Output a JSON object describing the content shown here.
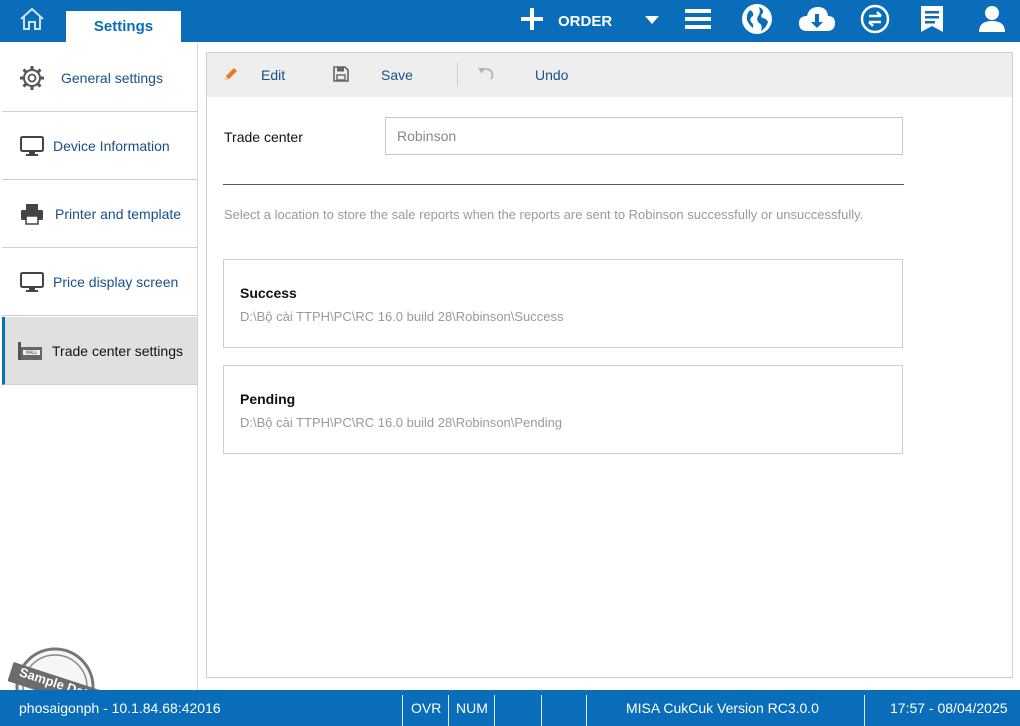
{
  "topbar": {
    "tab_label": "Settings",
    "order_label": "ORDER",
    "icons": [
      "home-icon",
      "plus-icon",
      "dropdown-arrow-icon",
      "menu-icon",
      "globe-icon",
      "cloud-download-icon",
      "sync-icon",
      "receipt-icon",
      "user-icon"
    ],
    "accent_color": "#0a6db9"
  },
  "sidebar": {
    "items": [
      {
        "label": "General settings",
        "icon": "gear-icon"
      },
      {
        "label": "Device Information",
        "icon": "monitor-icon"
      },
      {
        "label": "Printer and template",
        "icon": "printer-icon"
      },
      {
        "label": "Price display screen",
        "icon": "monitor-icon"
      },
      {
        "label": "Trade center settings",
        "icon": "mall-icon"
      }
    ],
    "active_index": 4,
    "stamp_text": "Sample Data"
  },
  "toolbar": {
    "edit_label": "Edit",
    "save_label": "Save",
    "undo_label": "Undo"
  },
  "form": {
    "trade_center_label": "Trade center",
    "trade_center_value": "Robinson",
    "hint": "Select a location to store the sale reports when the reports are sent to Robinson successfully or unsuccessfully.",
    "locations": [
      {
        "title": "Success",
        "path": "D:\\Bộ cài TTPH\\PC\\RC 16.0 build 28\\Robinson\\Success"
      },
      {
        "title": "Pending",
        "path": "D:\\Bộ cài TTPH\\PC\\RC 16.0 build 28\\Robinson\\Pending"
      }
    ]
  },
  "statusbar": {
    "user": "phosaigonph - 10.1.84.68:42016",
    "ovr": "OVR",
    "num": "NUM",
    "version": "MISA CukCuk Version RC3.0.0",
    "datetime": "17:57 - 08/04/2025"
  }
}
